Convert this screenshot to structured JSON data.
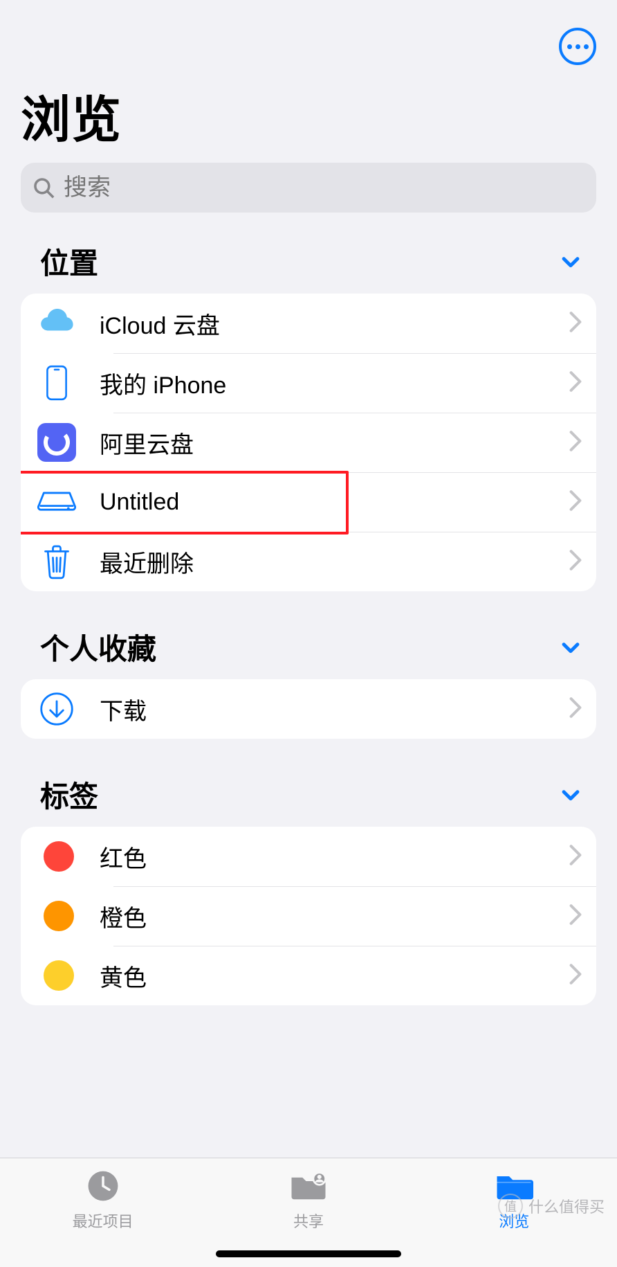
{
  "header": {
    "title": "浏览",
    "more_icon": "more-options"
  },
  "search": {
    "placeholder": "搜索"
  },
  "sections": {
    "locations": {
      "title": "位置",
      "items": [
        {
          "icon": "icloud-icon",
          "label": "iCloud 云盘"
        },
        {
          "icon": "iphone-icon",
          "label": "我的 iPhone"
        },
        {
          "icon": "aliyun-icon",
          "label": "阿里云盘"
        },
        {
          "icon": "external-drive-icon",
          "label": "Untitled",
          "highlighted": true
        },
        {
          "icon": "trash-icon",
          "label": "最近删除"
        }
      ]
    },
    "favorites": {
      "title": "个人收藏",
      "items": [
        {
          "icon": "download-icon",
          "label": "下载"
        }
      ]
    },
    "tags": {
      "title": "标签",
      "items": [
        {
          "color": "#fe453a",
          "label": "红色"
        },
        {
          "color": "#fe9500",
          "label": "橙色"
        },
        {
          "color": "#fdcf2b",
          "label": "黄色"
        }
      ]
    }
  },
  "tabbar": {
    "items": [
      {
        "icon": "clock-icon",
        "label": "最近项目",
        "active": false
      },
      {
        "icon": "shared-folder-icon",
        "label": "共享",
        "active": false
      },
      {
        "icon": "folder-icon",
        "label": "浏览",
        "active": true
      }
    ]
  },
  "watermark": {
    "badge": "值",
    "text": "什么值得买"
  }
}
